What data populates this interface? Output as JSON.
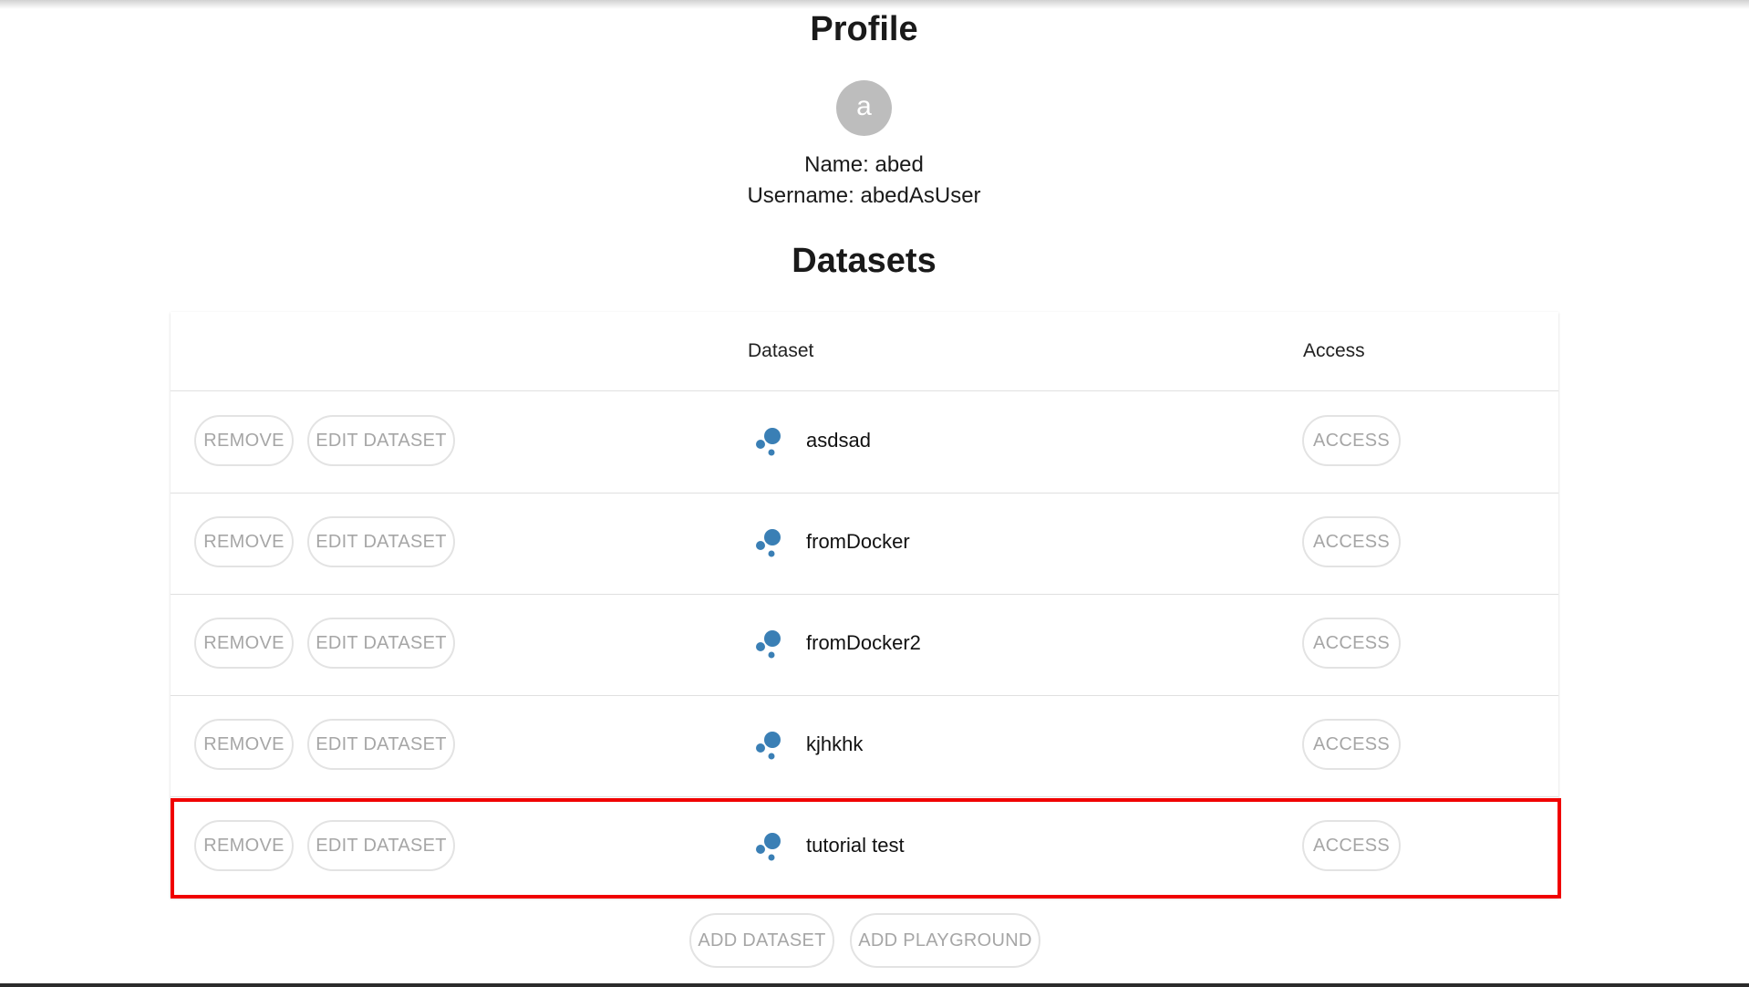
{
  "profile": {
    "title": "Profile",
    "avatar_letter": "a",
    "name_line": "Name: abed",
    "username_line": "Username: abedAsUser"
  },
  "datasets": {
    "title": "Datasets",
    "columns": {
      "dataset": "Dataset",
      "access": "Access"
    },
    "rows": [
      {
        "name": "asdsad",
        "remove_label": "REMOVE",
        "edit_label": "EDIT DATASET",
        "access_label": "ACCESS"
      },
      {
        "name": "fromDocker",
        "remove_label": "REMOVE",
        "edit_label": "EDIT DATASET",
        "access_label": "ACCESS"
      },
      {
        "name": "fromDocker2",
        "remove_label": "REMOVE",
        "edit_label": "EDIT DATASET",
        "access_label": "ACCESS"
      },
      {
        "name": "kjhkhk",
        "remove_label": "REMOVE",
        "edit_label": "EDIT DATASET",
        "access_label": "ACCESS"
      },
      {
        "name": "tutorial test",
        "remove_label": "REMOVE",
        "edit_label": "EDIT DATASET",
        "access_label": "ACCESS"
      }
    ],
    "highlighted_row": "tutorial test"
  },
  "actions": {
    "add_dataset_label": "ADD DATASET",
    "add_playground_label": "ADD PLAYGROUND"
  },
  "icons": {
    "dataset": "dataset-bubbles-icon"
  },
  "colors": {
    "dataset_icon": "#3a7fb5",
    "highlight": "#f00000",
    "avatar_bg": "#bdbdbd",
    "button_text": "#a6a6a6"
  }
}
